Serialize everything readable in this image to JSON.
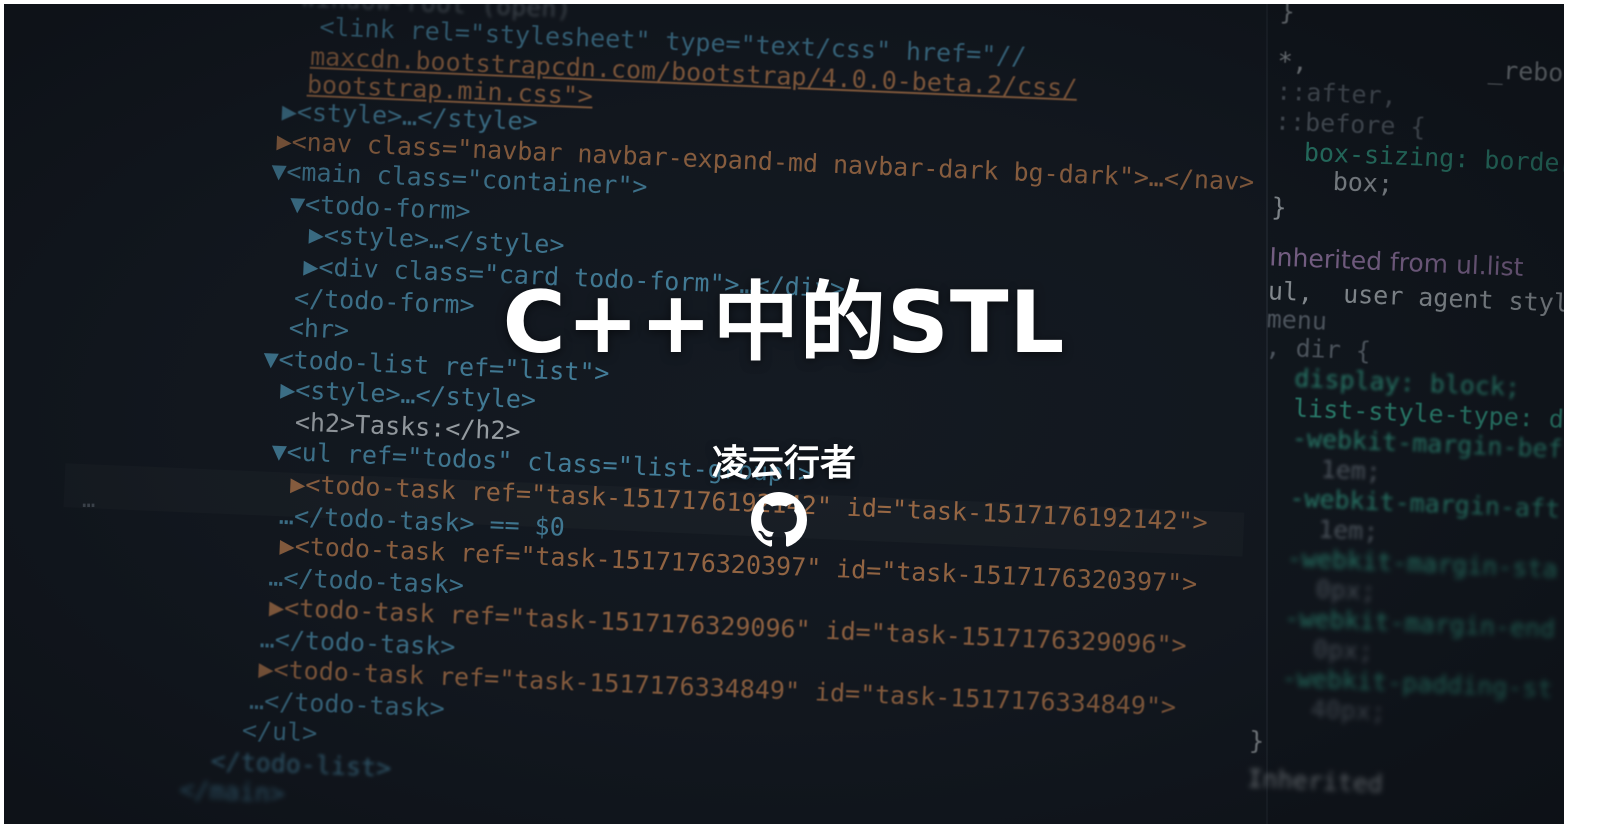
{
  "hero": {
    "title": "C++中的STL",
    "author": "凌云行者",
    "icon": "github-icon"
  },
  "code_lines": [
    "window-root (open)",
    "<link rel=\"stylesheet\" type=\"text/css\" href=\"//",
    "maxcdn.bootstrapcdn.com/bootstrap/4.0.0-beta.2/css/",
    "bootstrap.min.css\">",
    "▶<style>…</style>",
    "▶<nav class=\"navbar navbar-expand-md navbar-dark bg-dark\">…</nav>",
    "▼<main class=\"container\">",
    "▼<todo-form>",
    "▶<style>…</style>",
    "▶<div class=\"card todo-form\">…</div>",
    "</todo-form>",
    "<hr>",
    "▼<todo-list ref=\"list\">",
    "▶<style>…</style>",
    "<h2>Tasks:</h2>",
    "▼<ul ref=\"todos\" class=\"list-group\">",
    "▶<todo-task ref=\"task-1517176192142\" id=\"task-1517176192142\">",
    "…</todo-task> == $0",
    "▶<todo-task ref=\"task-1517176320397\" id=\"task-1517176320397\">",
    "…</todo-task>",
    "▶<todo-task ref=\"task-1517176329096\" id=\"task-1517176329096\">",
    "…</todo-task>",
    "▶<todo-task ref=\"task-1517176334849\" id=\"task-1517176334849\">",
    "…</todo-task>",
    "</ul>",
    "</todo-list>",
    "</main>"
  ],
  "gutter_text": "…",
  "styles_lines": [
    "}",
    "*,            _reboot.s",
    "::after,",
    "::before {",
    "  box-sizing: border-",
    "    box;",
    "}",
    "Inherited from ul.list",
    "ul,  user agent style",
    "menu",
    ", dir {",
    "  display: block;",
    "  list-style-type: d",
    "  -webkit-margin-bef",
    "    1em;",
    "  -webkit-margin-aft",
    "    1em;",
    "  -webkit-margin-sta",
    "    0px;",
    "  -webkit-margin-end",
    "    0px;",
    "  -webkit-padding-st",
    "    40px;",
    "}",
    "Inherited"
  ],
  "colors": {
    "background": "#171c24",
    "tag": "#5fb3d9",
    "attr_value": "#e0935a",
    "css_property": "#3ec9a7",
    "title_text": "#ffffff"
  }
}
